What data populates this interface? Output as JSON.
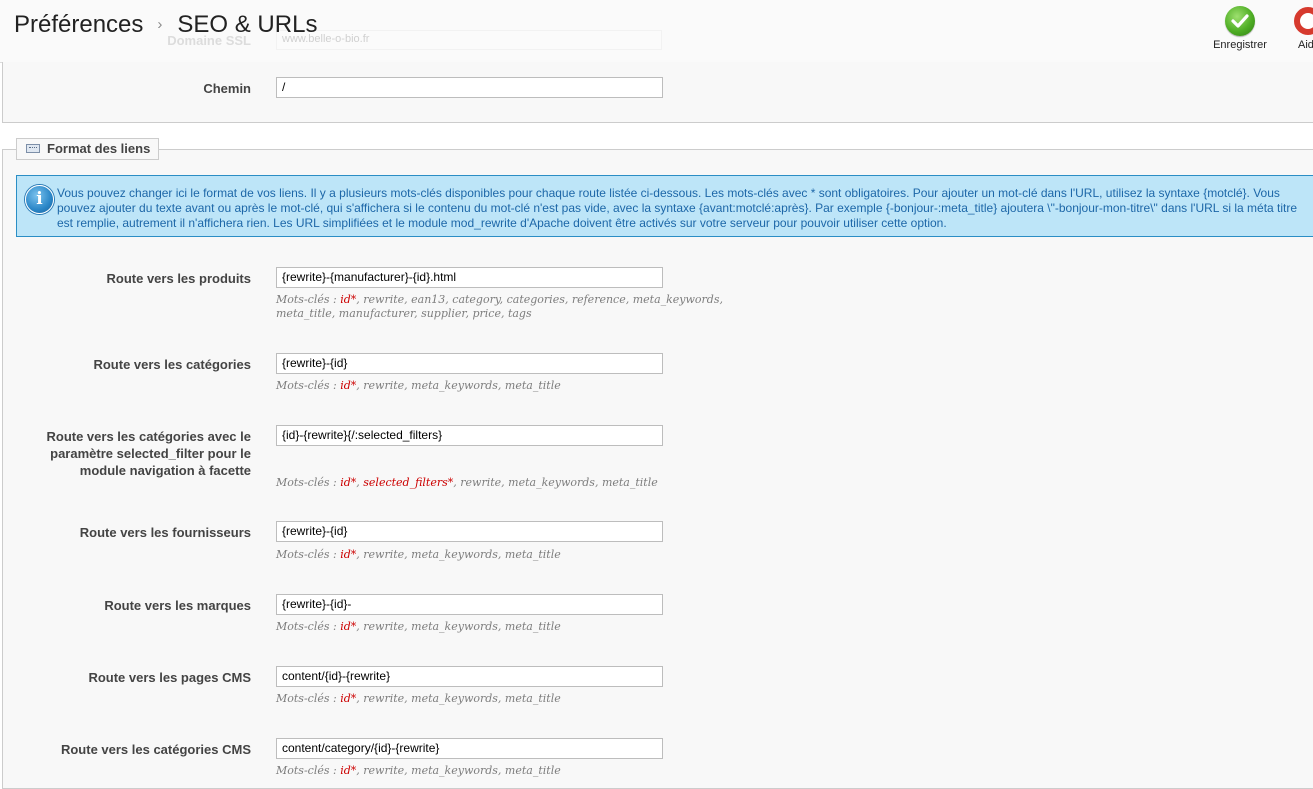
{
  "header": {
    "breadcrumb_parent": "Préférences",
    "breadcrumb_separator": "›",
    "breadcrumb_current": "SEO & URLs",
    "save_label": "Enregistrer",
    "help_label": "Aide",
    "ghost_label": "Domaine SSL",
    "ghost_value": "www.belle-o-bio.fr"
  },
  "path_field": {
    "label": "Chemin",
    "value": "/"
  },
  "section": {
    "legend": "Format des liens",
    "info_lines": [
      "Vous pouvez changer ici le format de vos liens. Il y a plusieurs mots-clés disponibles pour chaque route listée ci-dessous. Les mots-clés avec * sont obligatoires. Pour ajouter un mot-clé dans l'URL, utilisez la syntaxe {motclé}. Vous",
      "pouvez ajouter du texte avant ou après le mot-clé, qui s'affichera si le contenu du mot-clé n'est pas vide, avec la syntaxe {avant:motclé:après}. Par exemple {-bonjour-:meta_title} ajoutera \\\"-bonjour-mon-titre\\\" dans l'URL si la méta titre",
      "est remplie, autrement il n'affichera rien. Les URL simplifiées et le module mod_rewrite d'Apache doivent être activés sur votre serveur pour pouvoir utiliser cette option."
    ]
  },
  "keywords_prefix": "Mots-clés : ",
  "routes": [
    {
      "label": "Route vers les produits",
      "value": "{rewrite}-{manufacturer}-{id}.html",
      "req1": "id*",
      "req2": "",
      "rest": ", rewrite, ean13, category, categories, reference, meta_keywords,",
      "rest2": "meta_title, manufacturer, supplier, price, tags"
    },
    {
      "label": "Route vers les catégories",
      "value": "{rewrite}-{id}",
      "req1": "id*",
      "req2": "",
      "rest": ", rewrite, meta_keywords, meta_title",
      "rest2": ""
    },
    {
      "label_lines": [
        "Route vers les catégories avec le",
        "paramètre selected_filter pour le",
        "module navigation à facette"
      ],
      "value": "{id}-{rewrite}{/:selected_filters}",
      "req1": "id*",
      "req2": "selected_filters*",
      "rest": ", rewrite, meta_keywords, meta_title",
      "rest2": ""
    },
    {
      "label": "Route vers les fournisseurs",
      "value": "{rewrite}-{id}",
      "req1": "id*",
      "req2": "",
      "rest": ", rewrite, meta_keywords, meta_title",
      "rest2": ""
    },
    {
      "label": "Route vers les marques",
      "value": "{rewrite}-{id}-",
      "req1": "id*",
      "req2": "",
      "rest": ", rewrite, meta_keywords, meta_title",
      "rest2": ""
    },
    {
      "label": "Route vers les pages CMS",
      "value": "content/{id}-{rewrite}",
      "req1": "id*",
      "req2": "",
      "rest": ", rewrite, meta_keywords, meta_title",
      "rest2": ""
    },
    {
      "label": "Route vers les catégories CMS",
      "value": "content/category/{id}-{rewrite}",
      "req1": "id*",
      "req2": "",
      "rest": ", rewrite, meta_keywords, meta_title",
      "rest2": ""
    }
  ],
  "colors": {
    "info_border": "#2b8ec5",
    "info_background": "#bde5f8",
    "info_text": "#1d67a8",
    "required_keyword": "#cc0000",
    "save_icon": "#4fae25",
    "help_icon": "#d63a2e"
  },
  "icons": {
    "save": "green-check-circle-icon",
    "help": "lifebuoy-icon",
    "legend": "keyboard-icon",
    "info": "info-circle-icon"
  }
}
